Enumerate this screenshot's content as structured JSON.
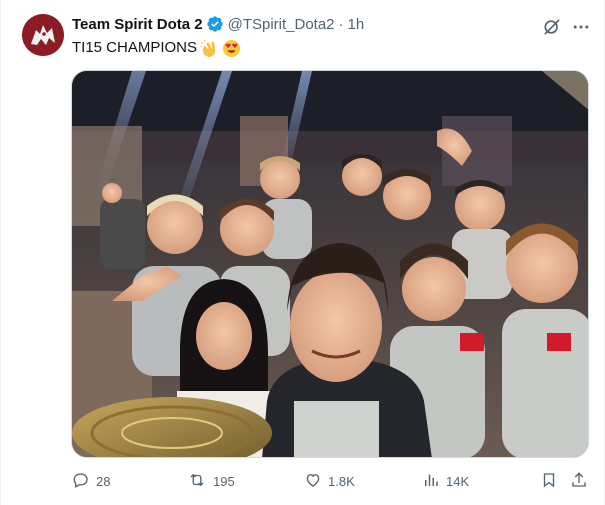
{
  "tweet": {
    "display_name": "Team Spirit Dota 2",
    "handle": "@TSpirit_Dota2",
    "separator": "·",
    "time": "1h",
    "text": "TI15 CHAMPIONS",
    "emojis": [
      "clapping-hands",
      "heart-eyes-face"
    ]
  },
  "icons": {
    "verified": "verified-badge-icon",
    "grok": "grok-icon",
    "more": "more-dots-icon",
    "reply": "reply-icon",
    "retweet": "retweet-icon",
    "like": "heart-icon",
    "views": "views-chart-icon",
    "bookmark": "bookmark-icon",
    "share": "share-icon"
  },
  "actions": {
    "replies": "28",
    "retweets": "195",
    "likes": "1.8K",
    "views": "14K"
  },
  "colors": {
    "verified": "#1d9bf0",
    "text": "#0f1419",
    "secondary": "#536471",
    "avatar_bg": "#8c1c24"
  }
}
